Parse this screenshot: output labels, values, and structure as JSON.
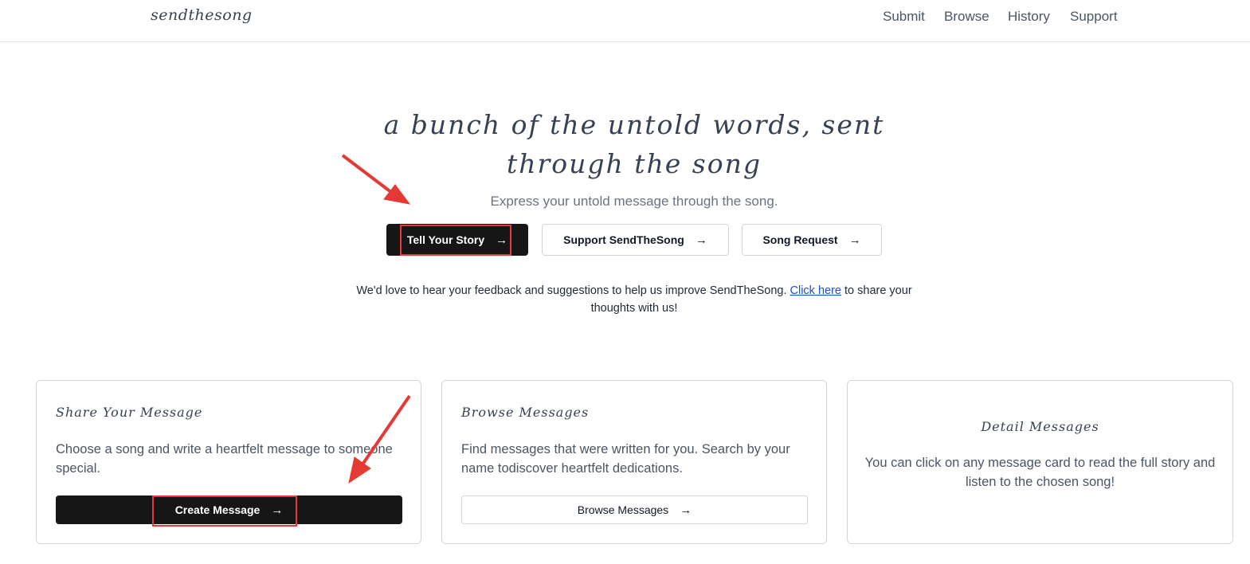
{
  "header": {
    "logo": "sendthesong",
    "nav": [
      "Submit",
      "Browse",
      "History",
      "Support"
    ]
  },
  "hero": {
    "title_line1": "a bunch of the untold words, sent",
    "title_line2": "through the song",
    "subtitle": "Express your untold message through the song.",
    "buttons": {
      "primary": "Tell Your Story",
      "support": "Support SendTheSong",
      "request": "Song Request"
    },
    "arrow_glyph": "→"
  },
  "feedback": {
    "text_before": "We'd love to hear your feedback and suggestions to help us improve SendTheSong. ",
    "link": "Click here",
    "text_after": " to share your thoughts with us!"
  },
  "cards": [
    {
      "title": "Share Your Message",
      "text": "Choose a song and write a heartfelt message to someone special.",
      "button": "Create Message"
    },
    {
      "title": "Browse Messages",
      "text": "Find messages that were written for you. Search by your name todiscover heartfelt dedications.",
      "button": "Browse Messages"
    },
    {
      "title": "Detail Messages",
      "text": "You can click on any message card to read the full story and listen to the chosen song!"
    }
  ],
  "colors": {
    "primary_button": "#161616",
    "annotation": "#e53935",
    "link": "#1d4ed8"
  }
}
